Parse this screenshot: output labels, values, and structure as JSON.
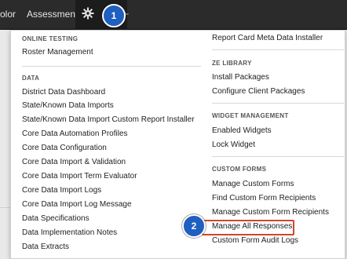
{
  "nav": {
    "items": [
      "olor",
      "Assessments"
    ],
    "gear_icon": "gear-icon"
  },
  "callouts": [
    "1",
    "2"
  ],
  "left_column": {
    "online_testing": {
      "title": "ONLINE TESTING",
      "items": [
        "Roster Management"
      ]
    },
    "data": {
      "title": "DATA",
      "items": [
        "District Data Dashboard",
        "State/Known Data Imports",
        "State/Known Data Import Custom Report Installer",
        "Core Data Automation Profiles",
        "Core Data Configuration",
        "Core Data Import & Validation",
        "Core Data Import Term Evaluator",
        "Core Data Import Logs",
        "Core Data Import Log Message",
        "Data Specifications",
        "Data Implementation Notes",
        "Data Extracts"
      ]
    }
  },
  "right_column": {
    "top": {
      "items": [
        "Report Card Meta Data Installer"
      ]
    },
    "ze_library": {
      "title": "ZE LIBRARY",
      "items": [
        "Install Packages",
        "Configure Client Packages"
      ]
    },
    "widget_management": {
      "title": "WIDGET MANAGEMENT",
      "items": [
        "Enabled Widgets",
        "Lock Widget"
      ]
    },
    "custom_forms": {
      "title": "CUSTOM FORMS",
      "items": [
        "Manage Custom Forms",
        "Find Custom Form Recipients",
        "Manage Custom Form Recipients",
        "Manage All Responses",
        "Custom Form Audit Logs"
      ]
    }
  },
  "colors": {
    "topbar": "#2b2b2b",
    "badge": "#1f5fbf",
    "highlight": "#d2452b"
  }
}
